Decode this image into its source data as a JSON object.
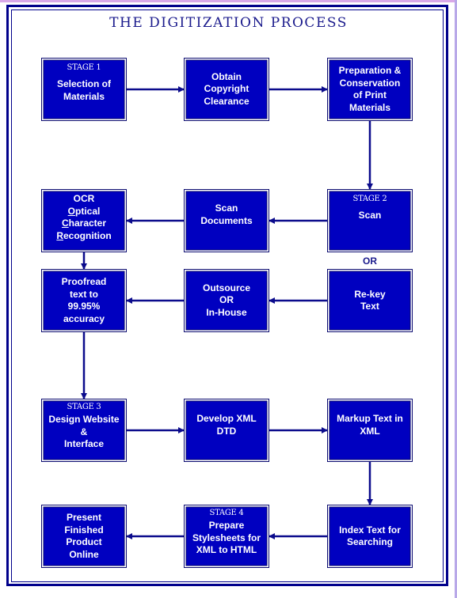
{
  "title": "THE DIGITIZATION PROCESS",
  "colors": {
    "box_fill": "#0000c0",
    "border": "#00008b",
    "text_on_box": "#ffffff",
    "title": "#1a1a8c"
  },
  "nodes": [
    {
      "id": "selection",
      "stage": "STAGE 1",
      "lines": [
        "Selection of",
        "Materials"
      ]
    },
    {
      "id": "copyright",
      "stage": "",
      "lines": [
        "Obtain",
        "Copyright",
        "Clearance"
      ]
    },
    {
      "id": "preparation",
      "stage": "",
      "lines": [
        "Preparation &",
        "Conservation",
        "of Print",
        "Materials"
      ]
    },
    {
      "id": "ocr",
      "stage": "",
      "lines": [
        "OCR",
        "Optical",
        "Character",
        "Recognition"
      ]
    },
    {
      "id": "scan-documents",
      "stage": "",
      "lines": [
        "Scan",
        "Documents"
      ]
    },
    {
      "id": "scan",
      "stage": "STAGE 2",
      "lines": [
        "Scan"
      ]
    },
    {
      "id": "proofread",
      "stage": "",
      "lines": [
        "Proofread",
        "text to",
        "99.95%",
        "accuracy"
      ]
    },
    {
      "id": "outsource",
      "stage": "",
      "lines": [
        "Outsource",
        "OR",
        "In-House"
      ]
    },
    {
      "id": "rekey",
      "stage": "",
      "lines": [
        "Re-key",
        "Text"
      ]
    },
    {
      "id": "design",
      "stage": "STAGE 3",
      "lines": [
        "Design Website",
        "&",
        "Interface"
      ]
    },
    {
      "id": "dtd",
      "stage": "",
      "lines": [
        "Develop XML",
        "DTD"
      ]
    },
    {
      "id": "markup",
      "stage": "",
      "lines": [
        "Markup Text in",
        "XML"
      ]
    },
    {
      "id": "present",
      "stage": "",
      "lines": [
        "Present",
        "Finished",
        "Product",
        "Online"
      ]
    },
    {
      "id": "stylesheets",
      "stage": "STAGE 4",
      "lines": [
        "Prepare",
        "Stylesheets for",
        "XML to HTML"
      ]
    },
    {
      "id": "index",
      "stage": "",
      "lines": [
        "Index Text for",
        "Searching"
      ]
    }
  ],
  "or_label": "OR",
  "edges": [
    {
      "from": "selection",
      "to": "copyright"
    },
    {
      "from": "copyright",
      "to": "preparation"
    },
    {
      "from": "preparation",
      "to": "scan"
    },
    {
      "from": "scan",
      "to": "scan-documents"
    },
    {
      "from": "scan-documents",
      "to": "ocr"
    },
    {
      "from": "ocr",
      "to": "proofread"
    },
    {
      "from": "rekey",
      "to": "outsource"
    },
    {
      "from": "outsource",
      "to": "proofread"
    },
    {
      "from": "proofread",
      "to": "design"
    },
    {
      "from": "design",
      "to": "dtd"
    },
    {
      "from": "dtd",
      "to": "markup"
    },
    {
      "from": "markup",
      "to": "index"
    },
    {
      "from": "index",
      "to": "stylesheets"
    },
    {
      "from": "stylesheets",
      "to": "present"
    }
  ]
}
